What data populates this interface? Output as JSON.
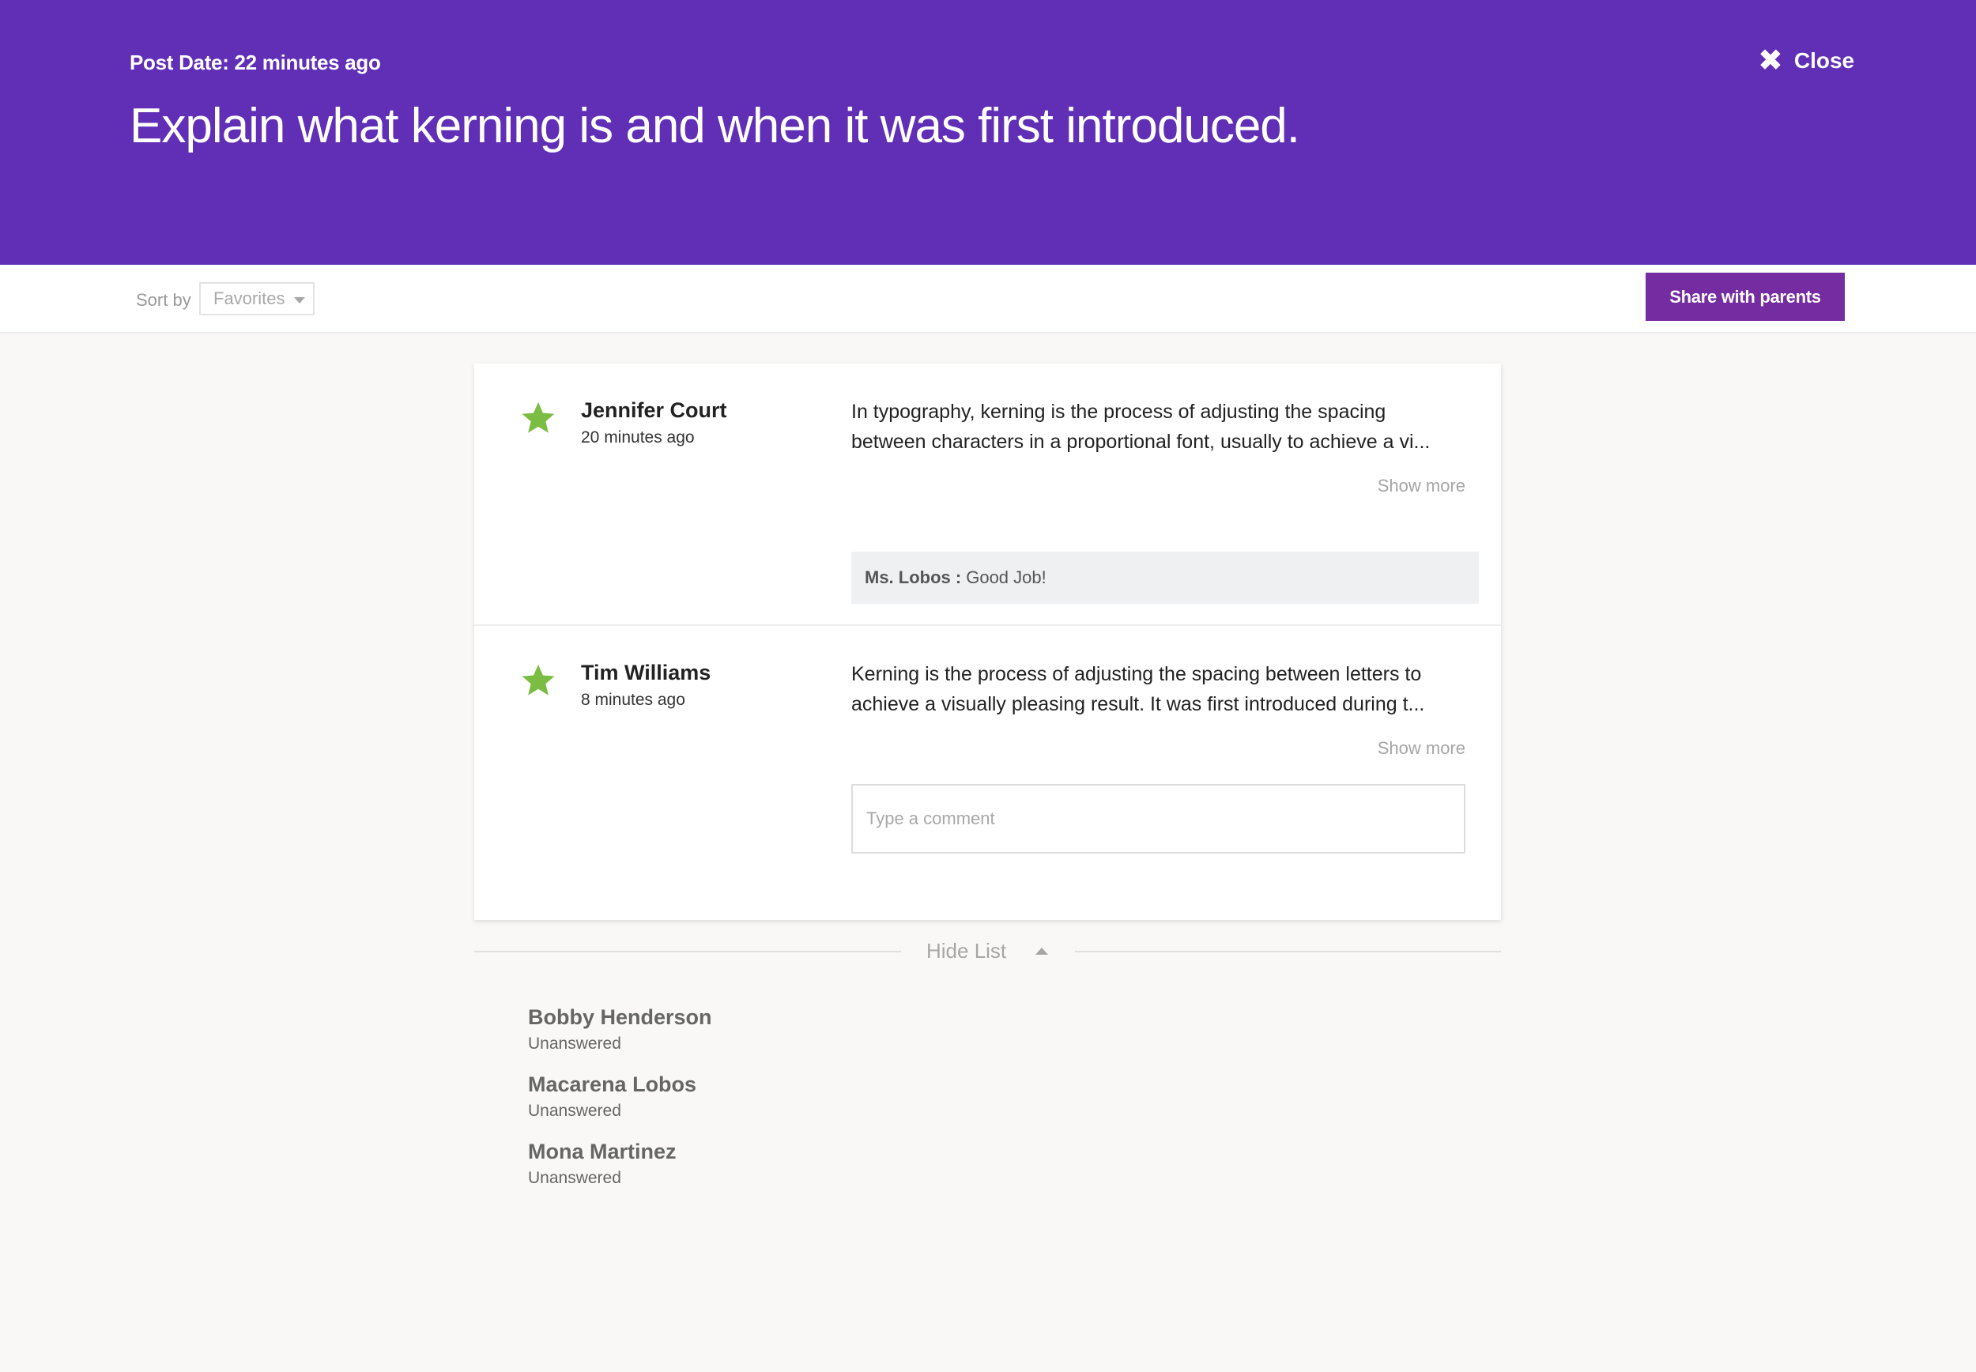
{
  "header": {
    "post_date": "Post Date: 22 minutes ago",
    "question": "Explain what kerning is and when it was first introduced.",
    "close_label": "Close",
    "background_color": "#602fb6"
  },
  "toolbar": {
    "sort_label": "Sort by",
    "sort_selected": "Favorites",
    "share_label": "Share with parents",
    "share_color": "#742ca0"
  },
  "responses": [
    {
      "author": "Jennifer Court",
      "time": "20 minutes ago",
      "favorite": true,
      "answer_lines": [
        "In typography, kerning  is the process of adjusting the spacing",
        "between characters in a proportional font, usually to achieve a vi..."
      ],
      "show_more": "Show more",
      "comment": {
        "author": "Ms. Lobos :",
        "text": "Good Job!"
      }
    },
    {
      "author": "Tim Williams",
      "time": "8 minutes ago",
      "favorite": true,
      "answer_lines": [
        "Kerning is the process of adjusting the spacing between letters to",
        "achieve a visually pleasing result. It was first introduced during t..."
      ],
      "show_more": "Show more",
      "comment_placeholder": "Type a comment"
    }
  ],
  "hide_list": {
    "label": "Hide List"
  },
  "unanswered": [
    {
      "name": "Bobby Henderson",
      "status": "Unanswered"
    },
    {
      "name": "Macarena Lobos",
      "status": "Unanswered"
    },
    {
      "name": "Mona Martinez",
      "status": "Unanswered"
    }
  ],
  "icons": {
    "star": "star-icon",
    "close": "close-icon",
    "star_color": "#7bbd42"
  }
}
